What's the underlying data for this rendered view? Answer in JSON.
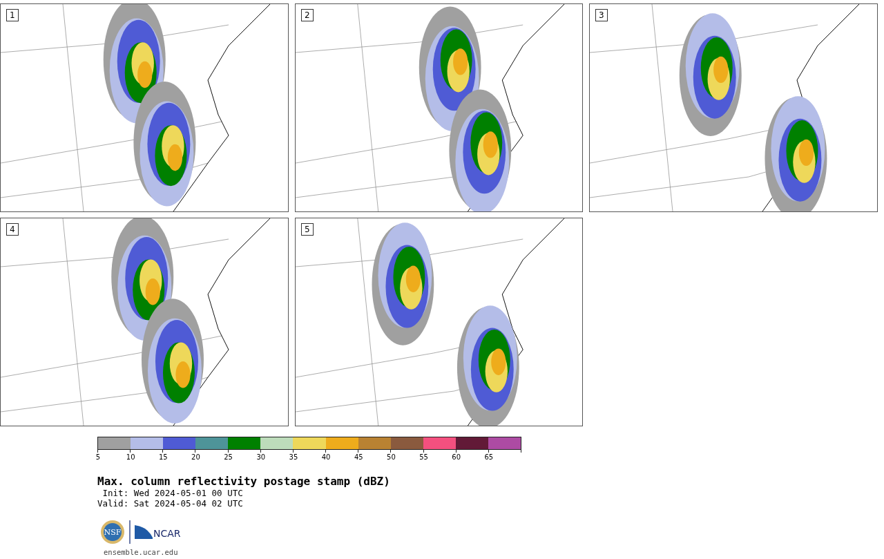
{
  "panels": [
    {
      "label": "1"
    },
    {
      "label": "2"
    },
    {
      "label": "3"
    },
    {
      "label": "4"
    },
    {
      "label": "5"
    }
  ],
  "colorbar": {
    "segments": [
      {
        "color": "#a0a0a0"
      },
      {
        "color": "#b4bde8"
      },
      {
        "color": "#4f5bd5"
      },
      {
        "color": "#4e9499"
      },
      {
        "color": "#008000"
      },
      {
        "color": "#bddcbb"
      },
      {
        "color": "#eed85a"
      },
      {
        "color": "#eeac1c"
      },
      {
        "color": "#b98232"
      },
      {
        "color": "#8a5a3e"
      },
      {
        "color": "#f4507f"
      },
      {
        "color": "#621a37"
      },
      {
        "color": "#ad4ba3"
      }
    ],
    "ticks": [
      "5",
      "10",
      "15",
      "20",
      "25",
      "30",
      "35",
      "40",
      "45",
      "50",
      "55",
      "60",
      "65"
    ]
  },
  "title": "Max. column reflectivity postage stamp (dBZ)",
  "init": " Init: Wed 2024-05-01 00 UTC",
  "valid": "Valid: Sat 2024-05-04 02 UTC",
  "logos": {
    "nsf": "NSF",
    "ncar": "NCAR"
  },
  "footer_link": "ensemble.ucar.edu"
}
